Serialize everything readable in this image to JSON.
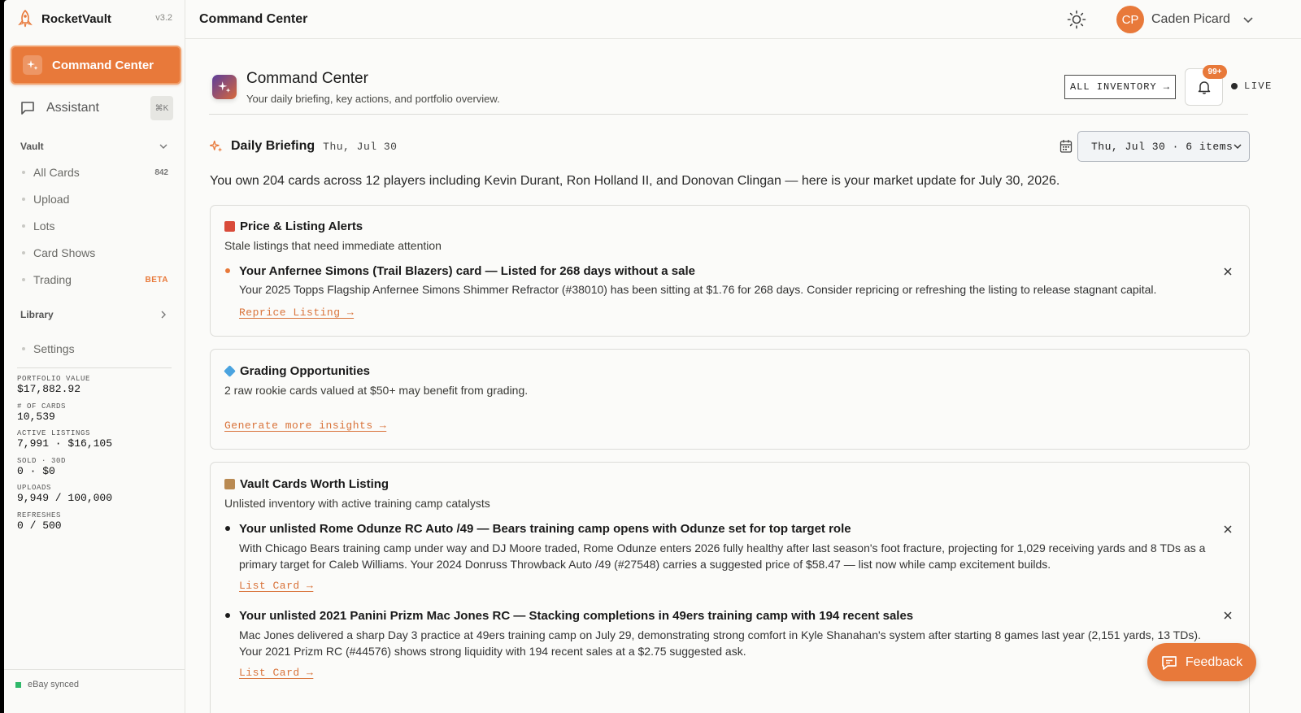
{
  "brand": {
    "name": "RocketVault",
    "version": "v3.2"
  },
  "sidebar": {
    "primary": {
      "label": "Command Center",
      "icon": "sparkle-icon"
    },
    "assistant": {
      "label": "Assistant",
      "shortcut": "⌘K"
    },
    "vault": {
      "label": "Vault",
      "items": [
        {
          "label": "All Cards",
          "count": "842"
        },
        {
          "label": "Upload"
        },
        {
          "label": "Lots"
        },
        {
          "label": "Card Shows"
        },
        {
          "label": "Trading",
          "badge": "BETA"
        }
      ]
    },
    "library": {
      "label": "Library"
    },
    "settings": {
      "label": "Settings"
    },
    "stats": [
      {
        "label": "PORTFOLIO VALUE",
        "value": "$17,882.92"
      },
      {
        "label": "# OF CARDS",
        "value": "10,539"
      },
      {
        "label": "ACTIVE LISTINGS",
        "value": "7,991 · $16,105"
      },
      {
        "label": "SOLD · 30D",
        "value": "0 · $0"
      },
      {
        "label": "UPLOADS",
        "value": "9,949 / 100,000"
      },
      {
        "label": "REFRESHES",
        "value": "0 / 500"
      }
    ],
    "sync_status": "eBay synced"
  },
  "topbar": {
    "title": "Command Center",
    "user": {
      "initials": "CP",
      "name": "Caden Picard"
    }
  },
  "page_header": {
    "title": "Command Center",
    "subtitle": "Your daily briefing, key actions, and portfolio overview.",
    "inventory_button": "ALL INVENTORY →",
    "notification_badge": "99+",
    "live_label": "LIVE"
  },
  "briefing": {
    "title": "Daily Briefing",
    "date": "Thu, Jul 30",
    "date_select": "Thu, Jul 30 · 6 items",
    "summary": "You own 204 cards across 12 players including Kevin Durant, Ron Holland II, and Donovan Clingan — here is your market update for July 30, 2026."
  },
  "sections": {
    "price_alerts": {
      "title": "Price & Listing Alerts",
      "subtitle": "Stale listings that need immediate attention",
      "items": [
        {
          "title": "Your Anfernee Simons (Trail Blazers) card — Listed for 268 days without a sale",
          "body": "Your 2025 Topps Flagship Anfernee Simons Shimmer Refractor (#38010) has been sitting at $1.76 for 268 days. Consider repricing or refreshing the listing to release stagnant capital.",
          "action": "Reprice Listing →"
        }
      ]
    },
    "grading": {
      "title": "Grading Opportunities",
      "subtitle": "2 raw rookie cards valued at $50+ may benefit from grading.",
      "action": "Generate more insights →"
    },
    "vault_listing": {
      "title": "Vault Cards Worth Listing",
      "subtitle": "Unlisted inventory with active training camp catalysts",
      "items": [
        {
          "title": "Your unlisted Rome Odunze RC Auto /49 — Bears training camp opens with Odunze set for top target role",
          "body": "With Chicago Bears training camp under way and DJ Moore traded, Rome Odunze enters 2026 fully healthy after last season's foot fracture, projecting for 1,029 receiving yards and 8 TDs as a primary target for Caleb Williams. Your 2024 Donruss Throwback Auto /49 (#27548) carries a suggested price of $58.47 — list now while camp excitement builds.",
          "action": "List Card →"
        },
        {
          "title": "Your unlisted 2021 Panini Prizm Mac Jones RC — Stacking completions in 49ers training camp with 194 recent sales",
          "body": "Mac Jones delivered a sharp Day 3 practice at 49ers training camp on July 29, demonstrating strong comfort in Kyle Shanahan's system after starting 8 games last year (2,151 yards, 13 TDs). Your 2021 Prizm RC (#44576) shows strong liquidity with 194 recent sales at a $2.75 suggested ask.",
          "action": "List Card →"
        }
      ]
    }
  },
  "feedback_button": "Feedback",
  "colors": {
    "accent": "#e8793a",
    "sync": "#2fb86a"
  }
}
